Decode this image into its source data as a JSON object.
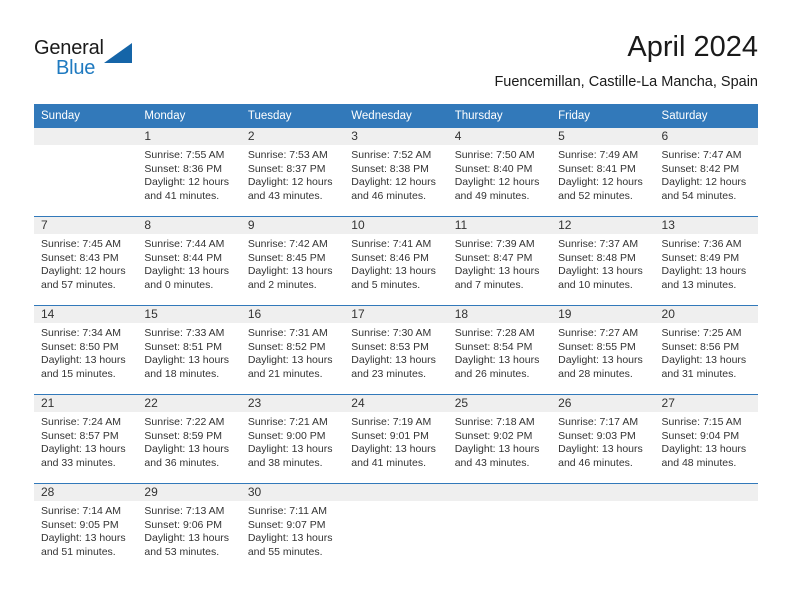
{
  "brand": {
    "name_part1": "General",
    "name_part2": "Blue",
    "logo_icon": "blue-triangle-icon"
  },
  "header": {
    "title": "April 2024",
    "subtitle": "Fuencemillan, Castille-La Mancha, Spain"
  },
  "colors": {
    "header_bar": "#3279BA",
    "daynum_strip": "#EFEFEF",
    "brand_blue": "#1F7AC0",
    "text": "#333333"
  },
  "calendar": {
    "weekday_headers": [
      "Sunday",
      "Monday",
      "Tuesday",
      "Wednesday",
      "Thursday",
      "Friday",
      "Saturday"
    ],
    "weeks": [
      [
        {
          "day": "",
          "sunrise": "",
          "sunset": "",
          "daylight_line1": "",
          "daylight_line2": ""
        },
        {
          "day": "1",
          "sunrise": "Sunrise: 7:55 AM",
          "sunset": "Sunset: 8:36 PM",
          "daylight_line1": "Daylight: 12 hours",
          "daylight_line2": "and 41 minutes."
        },
        {
          "day": "2",
          "sunrise": "Sunrise: 7:53 AM",
          "sunset": "Sunset: 8:37 PM",
          "daylight_line1": "Daylight: 12 hours",
          "daylight_line2": "and 43 minutes."
        },
        {
          "day": "3",
          "sunrise": "Sunrise: 7:52 AM",
          "sunset": "Sunset: 8:38 PM",
          "daylight_line1": "Daylight: 12 hours",
          "daylight_line2": "and 46 minutes."
        },
        {
          "day": "4",
          "sunrise": "Sunrise: 7:50 AM",
          "sunset": "Sunset: 8:40 PM",
          "daylight_line1": "Daylight: 12 hours",
          "daylight_line2": "and 49 minutes."
        },
        {
          "day": "5",
          "sunrise": "Sunrise: 7:49 AM",
          "sunset": "Sunset: 8:41 PM",
          "daylight_line1": "Daylight: 12 hours",
          "daylight_line2": "and 52 minutes."
        },
        {
          "day": "6",
          "sunrise": "Sunrise: 7:47 AM",
          "sunset": "Sunset: 8:42 PM",
          "daylight_line1": "Daylight: 12 hours",
          "daylight_line2": "and 54 minutes."
        }
      ],
      [
        {
          "day": "7",
          "sunrise": "Sunrise: 7:45 AM",
          "sunset": "Sunset: 8:43 PM",
          "daylight_line1": "Daylight: 12 hours",
          "daylight_line2": "and 57 minutes."
        },
        {
          "day": "8",
          "sunrise": "Sunrise: 7:44 AM",
          "sunset": "Sunset: 8:44 PM",
          "daylight_line1": "Daylight: 13 hours",
          "daylight_line2": "and 0 minutes."
        },
        {
          "day": "9",
          "sunrise": "Sunrise: 7:42 AM",
          "sunset": "Sunset: 8:45 PM",
          "daylight_line1": "Daylight: 13 hours",
          "daylight_line2": "and 2 minutes."
        },
        {
          "day": "10",
          "sunrise": "Sunrise: 7:41 AM",
          "sunset": "Sunset: 8:46 PM",
          "daylight_line1": "Daylight: 13 hours",
          "daylight_line2": "and 5 minutes."
        },
        {
          "day": "11",
          "sunrise": "Sunrise: 7:39 AM",
          "sunset": "Sunset: 8:47 PM",
          "daylight_line1": "Daylight: 13 hours",
          "daylight_line2": "and 7 minutes."
        },
        {
          "day": "12",
          "sunrise": "Sunrise: 7:37 AM",
          "sunset": "Sunset: 8:48 PM",
          "daylight_line1": "Daylight: 13 hours",
          "daylight_line2": "and 10 minutes."
        },
        {
          "day": "13",
          "sunrise": "Sunrise: 7:36 AM",
          "sunset": "Sunset: 8:49 PM",
          "daylight_line1": "Daylight: 13 hours",
          "daylight_line2": "and 13 minutes."
        }
      ],
      [
        {
          "day": "14",
          "sunrise": "Sunrise: 7:34 AM",
          "sunset": "Sunset: 8:50 PM",
          "daylight_line1": "Daylight: 13 hours",
          "daylight_line2": "and 15 minutes."
        },
        {
          "day": "15",
          "sunrise": "Sunrise: 7:33 AM",
          "sunset": "Sunset: 8:51 PM",
          "daylight_line1": "Daylight: 13 hours",
          "daylight_line2": "and 18 minutes."
        },
        {
          "day": "16",
          "sunrise": "Sunrise: 7:31 AM",
          "sunset": "Sunset: 8:52 PM",
          "daylight_line1": "Daylight: 13 hours",
          "daylight_line2": "and 21 minutes."
        },
        {
          "day": "17",
          "sunrise": "Sunrise: 7:30 AM",
          "sunset": "Sunset: 8:53 PM",
          "daylight_line1": "Daylight: 13 hours",
          "daylight_line2": "and 23 minutes."
        },
        {
          "day": "18",
          "sunrise": "Sunrise: 7:28 AM",
          "sunset": "Sunset: 8:54 PM",
          "daylight_line1": "Daylight: 13 hours",
          "daylight_line2": "and 26 minutes."
        },
        {
          "day": "19",
          "sunrise": "Sunrise: 7:27 AM",
          "sunset": "Sunset: 8:55 PM",
          "daylight_line1": "Daylight: 13 hours",
          "daylight_line2": "and 28 minutes."
        },
        {
          "day": "20",
          "sunrise": "Sunrise: 7:25 AM",
          "sunset": "Sunset: 8:56 PM",
          "daylight_line1": "Daylight: 13 hours",
          "daylight_line2": "and 31 minutes."
        }
      ],
      [
        {
          "day": "21",
          "sunrise": "Sunrise: 7:24 AM",
          "sunset": "Sunset: 8:57 PM",
          "daylight_line1": "Daylight: 13 hours",
          "daylight_line2": "and 33 minutes."
        },
        {
          "day": "22",
          "sunrise": "Sunrise: 7:22 AM",
          "sunset": "Sunset: 8:59 PM",
          "daylight_line1": "Daylight: 13 hours",
          "daylight_line2": "and 36 minutes."
        },
        {
          "day": "23",
          "sunrise": "Sunrise: 7:21 AM",
          "sunset": "Sunset: 9:00 PM",
          "daylight_line1": "Daylight: 13 hours",
          "daylight_line2": "and 38 minutes."
        },
        {
          "day": "24",
          "sunrise": "Sunrise: 7:19 AM",
          "sunset": "Sunset: 9:01 PM",
          "daylight_line1": "Daylight: 13 hours",
          "daylight_line2": "and 41 minutes."
        },
        {
          "day": "25",
          "sunrise": "Sunrise: 7:18 AM",
          "sunset": "Sunset: 9:02 PM",
          "daylight_line1": "Daylight: 13 hours",
          "daylight_line2": "and 43 minutes."
        },
        {
          "day": "26",
          "sunrise": "Sunrise: 7:17 AM",
          "sunset": "Sunset: 9:03 PM",
          "daylight_line1": "Daylight: 13 hours",
          "daylight_line2": "and 46 minutes."
        },
        {
          "day": "27",
          "sunrise": "Sunrise: 7:15 AM",
          "sunset": "Sunset: 9:04 PM",
          "daylight_line1": "Daylight: 13 hours",
          "daylight_line2": "and 48 minutes."
        }
      ],
      [
        {
          "day": "28",
          "sunrise": "Sunrise: 7:14 AM",
          "sunset": "Sunset: 9:05 PM",
          "daylight_line1": "Daylight: 13 hours",
          "daylight_line2": "and 51 minutes."
        },
        {
          "day": "29",
          "sunrise": "Sunrise: 7:13 AM",
          "sunset": "Sunset: 9:06 PM",
          "daylight_line1": "Daylight: 13 hours",
          "daylight_line2": "and 53 minutes."
        },
        {
          "day": "30",
          "sunrise": "Sunrise: 7:11 AM",
          "sunset": "Sunset: 9:07 PM",
          "daylight_line1": "Daylight: 13 hours",
          "daylight_line2": "and 55 minutes."
        },
        {
          "day": "",
          "sunrise": "",
          "sunset": "",
          "daylight_line1": "",
          "daylight_line2": ""
        },
        {
          "day": "",
          "sunrise": "",
          "sunset": "",
          "daylight_line1": "",
          "daylight_line2": ""
        },
        {
          "day": "",
          "sunrise": "",
          "sunset": "",
          "daylight_line1": "",
          "daylight_line2": ""
        },
        {
          "day": "",
          "sunrise": "",
          "sunset": "",
          "daylight_line1": "",
          "daylight_line2": ""
        }
      ]
    ]
  }
}
